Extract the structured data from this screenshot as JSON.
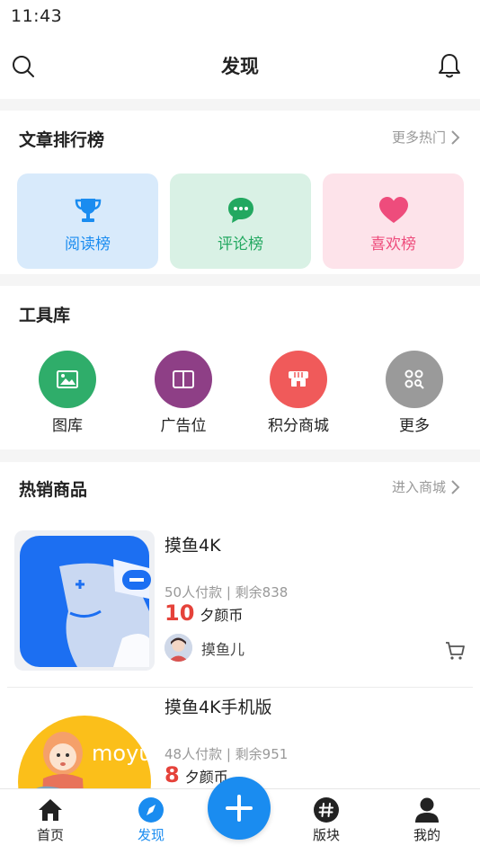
{
  "status_bar": {
    "time": "11:43"
  },
  "header": {
    "title": "发现",
    "left_icon": "search-icon",
    "right_icon": "bell-icon"
  },
  "ranking": {
    "title": "文章排行榜",
    "more_label": "更多热门",
    "cards": [
      {
        "label": "阅读榜",
        "icon": "trophy-icon",
        "bg": "#d8eafb",
        "color": "#1a8cf0"
      },
      {
        "label": "评论榜",
        "icon": "comment-icon",
        "bg": "#d9f1e5",
        "color": "#22a860"
      },
      {
        "label": "喜欢榜",
        "icon": "heart-icon",
        "bg": "#fde3ea",
        "color": "#ee4c7c"
      }
    ]
  },
  "tools": {
    "title": "工具库",
    "items": [
      {
        "label": "图库",
        "icon": "image-icon",
        "color": "#2fad6a"
      },
      {
        "label": "广告位",
        "icon": "book-icon",
        "color": "#8e3f86"
      },
      {
        "label": "积分商城",
        "icon": "shop-icon",
        "color": "#f05a5a"
      },
      {
        "label": "更多",
        "icon": "grid-more-icon",
        "color": "#9a9a9a"
      }
    ]
  },
  "hot_products": {
    "title": "热销商品",
    "more_label": "进入商城",
    "items": [
      {
        "name": "摸鱼4K",
        "meta": "50人付款 | 剩余838",
        "price": "10",
        "unit": "夕颜币",
        "seller": "摸鱼儿"
      },
      {
        "name": "摸鱼4K手机版",
        "meta": "48人付款 | 剩余951",
        "price": "8",
        "unit": "夕颜币",
        "thumb_text": "moyu"
      }
    ]
  },
  "tabbar": {
    "items": [
      {
        "label": "首页",
        "icon": "home-icon"
      },
      {
        "label": "发现",
        "icon": "compass-icon",
        "active": true
      },
      {
        "label": "版块",
        "icon": "hashtag-icon"
      },
      {
        "label": "我的",
        "icon": "user-icon"
      }
    ],
    "fab_icon": "plus-icon"
  },
  "colors": {
    "accent": "#1a8cf0",
    "price": "#e5423a",
    "muted": "#999999"
  }
}
